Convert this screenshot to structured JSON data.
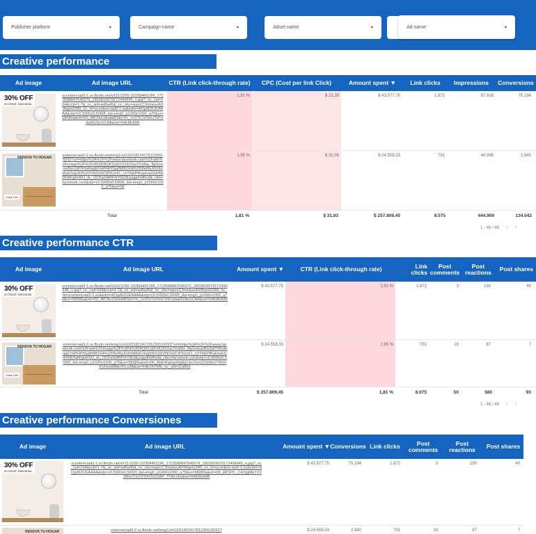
{
  "filters": {
    "publisher_platform": "Publisher platform",
    "campaign_name": "Campaign name",
    "adset_name": "Adset name",
    "ad_name": "Ad name"
  },
  "sections": {
    "s1": "Creative performance",
    "s2": "Creative performance CTR",
    "s3": "Creative performance Conversiones"
  },
  "creatives": {
    "a": {
      "big": "30% OFF",
      "small": "en transf. bancarias"
    },
    "b": {
      "brand": "RENOVA TU HOGAR",
      "tag": "Yulee Deb"
    }
  },
  "table1": {
    "headers": [
      "Ad image",
      "Ad image URL",
      "CTR (Link click-through rate)",
      "CPC (Cost per link Click)",
      "Amount spent ▼",
      "Link clicks",
      "Impressions",
      "Conversions"
    ],
    "rows": [
      {
        "url": "scontent-iad3-1.xx.fbcdn.net/v/t15.5256-10/358465186_1723588847545079_1801819579172496645_n.jpg?_nc_cat=104&ccb=1-7&_nc_sid=ad6a45&_nc_ohc=wpzcCJmzwuoAX9hgnG2R6_nc_ht=scontent-iad3-1.xx&edm=AOgd6ZUEAAAA&stp=c0.5000x0.5000f_dst-emg0_p1000x1000_q75&ur=58080a&oh=00_AfCNuUdnabiBSbvYIc_vo3Tk7xOmU7bFcIdakRZAsSCAA&oe=64E8EA9B",
        "ctr": "1,91 %",
        "cpc": "$ 23,28",
        "amount": "$ 43.577,75",
        "clicks": "1.872",
        "impressions": "97.918",
        "conversions": "75.194"
      },
      {
        "url": "external-iad3-2.xx.fbcdn.net/emg1/v/t13/2182241781236518263?url=https%3A%2F%2Fwww.facebook.com%2Fads%2Fimage%2F%3Fd%3DAQKCq0cOU3SSw1YuWw_8gSowuwBwJyRYKbdhqqEVHPHPtSjaBI8B1RA%2D8eI8qJGh9dMsE2HgSN%2DVNOn0CIP5UoII1_nVYbEPfKaHndsG4rN9DNAFgtmI0iJ_dc_OCKaSMRFHY6E0EjuqgrKldRvd&_nbo=facebook.com&stp=c0.5000x0.5000f_dst-emg0_p1000x1000_q75&ur=58",
        "ctr": "1,95 %",
        "cpc": "$ 31,05",
        "amount": "$ 24.558,33",
        "clicks": "791",
        "impressions": "40.996",
        "conversions": "2.940"
      }
    ],
    "total_label": "Total",
    "totals": {
      "ctr": "1,81 %",
      "cpc": "$ 31,93",
      "amount": "$ 257.809,45",
      "clicks": "8.075",
      "impressions": "444.909",
      "conversions": "134.042"
    },
    "pager": "1 - 46 / 46"
  },
  "table2": {
    "headers": [
      "Ad image",
      "Ad image URL",
      "Amount spent ▼",
      "CTR (Link click-through rate)",
      "Link clicks",
      "Post comments",
      "Post reactions",
      "Post shares"
    ],
    "rows": [
      {
        "url": "scontent-iad3-1.xx.fbcdn.net/v/t15.5256-10/358465186_1723588847545079_1801819579172496645_n.jpg?_nc_cat=104&ccb=1-7&_nc_sid=ad6a45&_nc_ohc=wpzcCJmzwuoAX9hgnG2R6_nc_ht=scontent-iad3-1.xx&edm=AOgd6ZUEAAAA&stp=c0.5000x0.5000f_dst-emg0_p1000x1000_q75&ur=58080a&oh=00_AfCNuUdnabiBSbvYIc_vo3Tk7xOmU7bFcIdakRZAsSCAA&oe=64E8EA9B",
        "amount": "$ 43.577,75",
        "ctr": "1,91 %",
        "clicks": "1.872",
        "comments": "3",
        "reactions": "150",
        "shares": "40"
      },
      {
        "url": "external-iad3-2.xx.fbcdn.net/emg1/v/t13/2182241781236518263?url=https%3A%2F%2Fwww.facebook.com%2Fads%2Fimage%2F%3Fd%3DAQKCq0cOU3SSw1YuWw_8gSowuwBwJyRYKbdhqqEVHPHPtSjaBI8B1RA%2D8eI8qJGh9dMsE2HgSN%2DVNOn0CIP5UoII1_nVYbEPfKaHndsG4rN9DNAFgtmI0iJ_dc_OCKaSMRFHY6E0EjuqgrKldRvd&_nbo=facebook.com&stp=c0.5000x0.5000f_dst-emg0_p1000x1000_q75&ur=58080a&oh=06_AbEWqtzgrWg8g19e23sxQ2d5Be2TNXFKVOunMMpVFLx3A&oe=64E547946_nc_sid=31d854",
        "amount": "$ 24.558,33",
        "ctr": "1,95 %",
        "clicks": "791",
        "comments": "19",
        "reactions": "87",
        "shares": "7"
      }
    ],
    "total_label": "Total",
    "totals": {
      "amount": "$ 257.809,45",
      "ctr": "1,81 %",
      "clicks": "8.075",
      "comments": "50",
      "reactions": "580",
      "shares": "93"
    },
    "pager": "1 - 46 / 46"
  },
  "table3": {
    "headers": [
      "Ad image",
      "Ad image URL",
      "Amount spent ▼",
      "Conversions",
      "Link clicks",
      "Post comments",
      "Post reactions",
      "Post shares"
    ],
    "rows": [
      {
        "url": "scontent-iad3-1.xx.fbcdn.net/v/t15.5256-10/358465186_1723588847545079_1801819579172496645_n.jpg?_nc_cat=104&ccb=1-7&_nc_sid=ad6a45&_nc_ohc=wpzcCJmzwuoAX9hgnG2R6_nc_ht=scontent-iad3-1.xx&edm=AOgd6ZUEAAAA&stp=c0.5000x0.5000f_dst-emg0_p1000x1000_q75&ur=58080a&oh=00_AfCRTc_C4OgjIRkTVV18ho72zr03TjKOUxSAP_TFibrJJw&oe=64E8EA9B",
        "amount": "$ 43.577,75",
        "conversions": "75.194",
        "clicks": "1.872",
        "comments": "3",
        "reactions": "150",
        "shares": "40"
      },
      {
        "url": "external-iad3-2.xx.fbcdn.net/emg1/v/t13/2182241781236518263?",
        "amount": "$ 24.558,33",
        "conversions": "2.940",
        "clicks": "791",
        "comments": "19",
        "reactions": "87",
        "shares": "7"
      }
    ]
  }
}
